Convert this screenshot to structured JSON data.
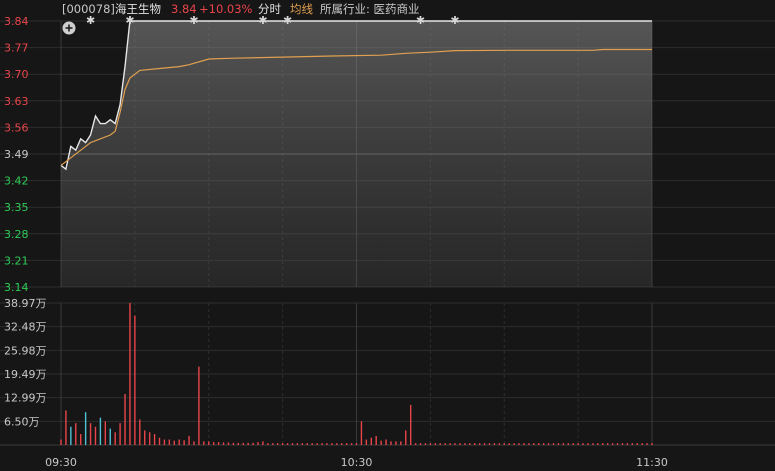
{
  "header": {
    "code": "[000078]",
    "name": "海王生物",
    "price": "3.84",
    "change": "+10.03%",
    "mode": "分时",
    "avg_label": "均线",
    "industry": "所属行业: 医药商业"
  },
  "colors": {
    "background": "#161616",
    "up": "#e8454a",
    "down": "#2ecc57",
    "neutral": "#c8c8c8",
    "price_line": "#e6e6e6",
    "avg_line": "#e0a050",
    "volume_blue": "#4fc3d6",
    "grid": "#2e2e2e"
  },
  "chart_data": [
    {
      "type": "line",
      "title": "分时",
      "x_range": [
        "09:30",
        "11:30"
      ],
      "ylim": [
        3.14,
        3.84
      ],
      "prev_close": 3.49,
      "y_ticks": [
        "3.84",
        "3.77",
        "3.70",
        "3.63",
        "3.56",
        "3.49",
        "3.42",
        "3.35",
        "3.28",
        "3.21",
        "3.14"
      ],
      "x_ticks": [
        {
          "minute": 0,
          "label": "09:30"
        },
        {
          "minute": 60,
          "label": "10:30"
        },
        {
          "minute": 120,
          "label": "11:30"
        }
      ],
      "series": [
        {
          "name": "price",
          "points": [
            [
              0,
              3.46
            ],
            [
              1,
              3.45
            ],
            [
              2,
              3.51
            ],
            [
              3,
              3.5
            ],
            [
              4,
              3.53
            ],
            [
              5,
              3.52
            ],
            [
              6,
              3.54
            ],
            [
              7,
              3.59
            ],
            [
              8,
              3.57
            ],
            [
              9,
              3.57
            ],
            [
              10,
              3.58
            ],
            [
              11,
              3.57
            ],
            [
              12,
              3.62
            ],
            [
              13,
              3.72
            ],
            [
              14,
              3.84
            ],
            [
              120,
              3.84
            ]
          ]
        },
        {
          "name": "均线",
          "points": [
            [
              0,
              3.46
            ],
            [
              2,
              3.48
            ],
            [
              4,
              3.5
            ],
            [
              6,
              3.52
            ],
            [
              8,
              3.53
            ],
            [
              10,
              3.54
            ],
            [
              11,
              3.55
            ],
            [
              12,
              3.6
            ],
            [
              13,
              3.66
            ],
            [
              14,
              3.69
            ],
            [
              16,
              3.71
            ],
            [
              20,
              3.715
            ],
            [
              24,
              3.72
            ],
            [
              26,
              3.725
            ],
            [
              30,
              3.74
            ],
            [
              35,
              3.742
            ],
            [
              45,
              3.745
            ],
            [
              55,
              3.748
            ],
            [
              65,
              3.75
            ],
            [
              70,
              3.755
            ],
            [
              75,
              3.758
            ],
            [
              80,
              3.762
            ],
            [
              90,
              3.763
            ],
            [
              108,
              3.763
            ],
            [
              110,
              3.765
            ],
            [
              120,
              3.765
            ]
          ]
        }
      ],
      "markers_minutes": [
        6,
        14,
        27,
        41,
        46,
        73,
        80
      ]
    },
    {
      "type": "bar",
      "title": "成交量",
      "ylim": [
        0,
        38.97
      ],
      "unit": "万",
      "y_ticks": [
        "38.97万",
        "32.48万",
        "25.98万",
        "19.49万",
        "12.99万",
        "6.50万"
      ],
      "bars": [
        [
          0,
          1.5,
          "r"
        ],
        [
          1,
          9.5,
          "r"
        ],
        [
          2,
          5.0,
          "b"
        ],
        [
          3,
          6.0,
          "r"
        ],
        [
          4,
          3.0,
          "r"
        ],
        [
          5,
          9.0,
          "b"
        ],
        [
          6,
          6.0,
          "r"
        ],
        [
          7,
          5.0,
          "r"
        ],
        [
          8,
          7.5,
          "b"
        ],
        [
          9,
          6.5,
          "r"
        ],
        [
          10,
          4.5,
          "b"
        ],
        [
          11,
          3.5,
          "r"
        ],
        [
          12,
          6.0,
          "r"
        ],
        [
          13,
          14.0,
          "r"
        ],
        [
          14,
          38.97,
          "r"
        ],
        [
          15,
          35.5,
          "r"
        ],
        [
          16,
          7.0,
          "r"
        ],
        [
          17,
          4.0,
          "r"
        ],
        [
          18,
          3.5,
          "r"
        ],
        [
          19,
          3.0,
          "r"
        ],
        [
          20,
          2.0,
          "r"
        ],
        [
          21,
          1.5,
          "r"
        ],
        [
          22,
          1.5,
          "r"
        ],
        [
          23,
          1.2,
          "r"
        ],
        [
          24,
          1.5,
          "r"
        ],
        [
          25,
          1.3,
          "r"
        ],
        [
          26,
          2.5,
          "r"
        ],
        [
          27,
          1.0,
          "r"
        ],
        [
          28,
          21.5,
          "r"
        ],
        [
          29,
          1.0,
          "r"
        ],
        [
          30,
          1.0,
          "r"
        ],
        [
          31,
          0.8,
          "r"
        ],
        [
          32,
          0.8,
          "r"
        ],
        [
          33,
          0.7,
          "r"
        ],
        [
          34,
          0.7,
          "r"
        ],
        [
          35,
          0.6,
          "r"
        ],
        [
          36,
          0.6,
          "r"
        ],
        [
          37,
          0.6,
          "r"
        ],
        [
          38,
          0.6,
          "r"
        ],
        [
          39,
          0.6,
          "r"
        ],
        [
          40,
          0.8,
          "r"
        ],
        [
          41,
          1.0,
          "r"
        ],
        [
          42,
          0.5,
          "r"
        ],
        [
          43,
          0.5,
          "r"
        ],
        [
          44,
          0.5,
          "r"
        ],
        [
          45,
          0.5,
          "r"
        ],
        [
          46,
          0.5,
          "r"
        ],
        [
          47,
          0.5,
          "r"
        ],
        [
          48,
          0.5,
          "r"
        ],
        [
          49,
          0.5,
          "r"
        ],
        [
          50,
          0.5,
          "r"
        ],
        [
          51,
          0.5,
          "r"
        ],
        [
          52,
          0.5,
          "r"
        ],
        [
          53,
          0.5,
          "r"
        ],
        [
          54,
          0.5,
          "r"
        ],
        [
          55,
          0.5,
          "r"
        ],
        [
          56,
          0.5,
          "r"
        ],
        [
          57,
          0.5,
          "r"
        ],
        [
          58,
          0.5,
          "r"
        ],
        [
          59,
          0.5,
          "r"
        ],
        [
          60,
          0.5,
          "r"
        ],
        [
          61,
          6.5,
          "r"
        ],
        [
          62,
          1.5,
          "r"
        ],
        [
          63,
          2.0,
          "r"
        ],
        [
          64,
          2.5,
          "r"
        ],
        [
          65,
          1.2,
          "r"
        ],
        [
          66,
          1.5,
          "r"
        ],
        [
          67,
          1.0,
          "r"
        ],
        [
          68,
          1.0,
          "r"
        ],
        [
          69,
          1.0,
          "r"
        ],
        [
          70,
          4.0,
          "r"
        ],
        [
          71,
          11.0,
          "r"
        ],
        [
          72,
          0.5,
          "r"
        ],
        [
          73,
          0.5,
          "r"
        ],
        [
          74,
          0.5,
          "r"
        ],
        [
          75,
          0.5,
          "r"
        ],
        [
          76,
          0.5,
          "r"
        ],
        [
          77,
          0.5,
          "r"
        ],
        [
          78,
          0.5,
          "r"
        ],
        [
          79,
          0.5,
          "r"
        ],
        [
          80,
          0.5,
          "r"
        ],
        [
          81,
          0.5,
          "r"
        ],
        [
          82,
          0.5,
          "r"
        ],
        [
          83,
          0.5,
          "r"
        ],
        [
          84,
          0.5,
          "r"
        ],
        [
          85,
          0.5,
          "r"
        ],
        [
          86,
          0.5,
          "r"
        ],
        [
          87,
          0.5,
          "r"
        ],
        [
          88,
          0.5,
          "r"
        ],
        [
          89,
          0.5,
          "r"
        ],
        [
          90,
          0.5,
          "r"
        ],
        [
          91,
          0.5,
          "r"
        ],
        [
          92,
          0.5,
          "r"
        ],
        [
          93,
          0.5,
          "r"
        ],
        [
          94,
          0.5,
          "r"
        ],
        [
          95,
          0.5,
          "r"
        ],
        [
          96,
          0.5,
          "r"
        ],
        [
          97,
          0.5,
          "r"
        ],
        [
          98,
          0.5,
          "r"
        ],
        [
          99,
          0.5,
          "r"
        ],
        [
          100,
          0.5,
          "r"
        ],
        [
          101,
          0.5,
          "r"
        ],
        [
          102,
          0.5,
          "r"
        ],
        [
          103,
          0.5,
          "r"
        ],
        [
          104,
          0.5,
          "r"
        ],
        [
          105,
          0.5,
          "r"
        ],
        [
          106,
          0.5,
          "r"
        ],
        [
          107,
          0.5,
          "r"
        ],
        [
          108,
          0.5,
          "r"
        ],
        [
          109,
          0.5,
          "r"
        ],
        [
          110,
          0.5,
          "r"
        ],
        [
          111,
          0.5,
          "r"
        ],
        [
          112,
          0.5,
          "r"
        ],
        [
          113,
          0.5,
          "r"
        ],
        [
          114,
          0.5,
          "r"
        ],
        [
          115,
          0.5,
          "r"
        ],
        [
          116,
          0.5,
          "r"
        ],
        [
          117,
          0.5,
          "r"
        ],
        [
          118,
          0.5,
          "r"
        ],
        [
          119,
          0.5,
          "r"
        ],
        [
          120,
          0.5,
          "r"
        ]
      ]
    }
  ]
}
